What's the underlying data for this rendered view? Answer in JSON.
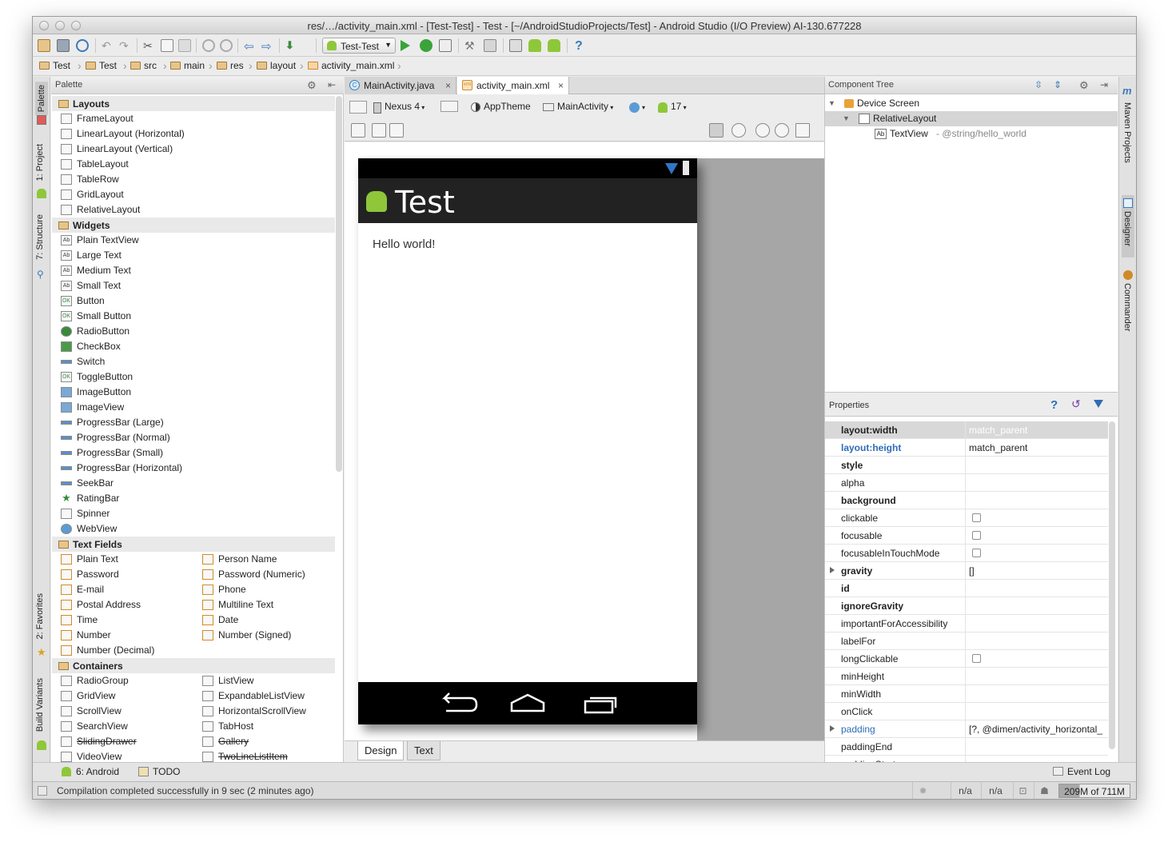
{
  "window": {
    "title": "res/…/activity_main.xml - [Test-Test] - Test - [~/AndroidStudioProjects/Test] - Android Studio (I/O Preview) AI-130.677228"
  },
  "toolbar": {
    "run_config": "Test-Test",
    "help": "?"
  },
  "breadcrumb": [
    "Test",
    "Test",
    "src",
    "main",
    "res",
    "layout",
    "activity_main.xml"
  ],
  "left_strip": {
    "palette": "Palette",
    "project": "1: Project",
    "structure": "7: Structure",
    "favorites": "2: Favorites",
    "build_variants": "Build Variants"
  },
  "right_strip": {
    "maven": "Maven Projects",
    "designer": "Designer",
    "commander": "Commander"
  },
  "palette": {
    "title": "Palette",
    "groups": {
      "layouts": "Layouts",
      "widgets": "Widgets",
      "text_fields": "Text Fields",
      "containers": "Containers"
    },
    "layouts": [
      "FrameLayout",
      "LinearLayout (Horizontal)",
      "LinearLayout (Vertical)",
      "TableLayout",
      "TableRow",
      "GridLayout",
      "RelativeLayout"
    ],
    "widgets": [
      "Plain TextView",
      "Large Text",
      "Medium Text",
      "Small Text",
      "Button",
      "Small Button",
      "RadioButton",
      "CheckBox",
      "Switch",
      "ToggleButton",
      "ImageButton",
      "ImageView",
      "ProgressBar (Large)",
      "ProgressBar (Normal)",
      "ProgressBar (Small)",
      "ProgressBar (Horizontal)",
      "SeekBar",
      "RatingBar",
      "Spinner",
      "WebView"
    ],
    "text_fields_left": [
      "Plain Text",
      "Password",
      "E-mail",
      "Postal Address",
      "Time",
      "Number",
      "Number (Decimal)"
    ],
    "text_fields_right": [
      "Person Name",
      "Password (Numeric)",
      "Phone",
      "Multiline Text",
      "Date",
      "Number (Signed)"
    ],
    "containers_left": [
      "RadioGroup",
      "GridView",
      "ScrollView",
      "SearchView",
      "SlidingDrawer",
      "VideoView"
    ],
    "containers_right": [
      "ListView",
      "ExpandableListView",
      "HorizontalScrollView",
      "TabHost",
      "Gallery",
      "TwoLineListItem"
    ],
    "icon_text": {
      "ab": "Ab",
      "ok": "OK"
    }
  },
  "editor": {
    "tabs": [
      {
        "label": "MainActivity.java",
        "icon": "C"
      },
      {
        "label": "activity_main.xml",
        "icon": "xml"
      }
    ],
    "close_glyph": "×",
    "device": "Nexus 4",
    "theme": "AppTheme",
    "activity": "MainActivity",
    "api": "17",
    "design_tabs": [
      "Design",
      "Text"
    ]
  },
  "preview": {
    "app_title": "Test",
    "hello": "Hello world!"
  },
  "component_tree": {
    "title": "Component Tree",
    "device_screen": "Device Screen",
    "relative_layout": "RelativeLayout",
    "text_view": "TextView",
    "text_view_detail": "- @string/hello_world"
  },
  "properties": {
    "title": "Properties",
    "help": "?",
    "rows": [
      {
        "name": "layout:width",
        "value": "match_parent"
      },
      {
        "name": "layout:height",
        "value": "match_parent"
      },
      {
        "name": "style",
        "value": ""
      },
      {
        "name": "alpha",
        "value": ""
      },
      {
        "name": "background",
        "value": ""
      },
      {
        "name": "clickable",
        "value": ""
      },
      {
        "name": "focusable",
        "value": ""
      },
      {
        "name": "focusableInTouchMode",
        "value": ""
      },
      {
        "name": "gravity",
        "value": "[]"
      },
      {
        "name": "id",
        "value": ""
      },
      {
        "name": "ignoreGravity",
        "value": ""
      },
      {
        "name": "importantForAccessibility",
        "value": ""
      },
      {
        "name": "labelFor",
        "value": ""
      },
      {
        "name": "longClickable",
        "value": ""
      },
      {
        "name": "minHeight",
        "value": ""
      },
      {
        "name": "minWidth",
        "value": ""
      },
      {
        "name": "onClick",
        "value": ""
      },
      {
        "name": "padding",
        "value": "[?, @dimen/activity_horizontal_"
      },
      {
        "name": "paddingEnd",
        "value": ""
      },
      {
        "name": "paddingStart",
        "value": ""
      }
    ]
  },
  "bottom_tools": {
    "android": "6: Android",
    "todo": "TODO",
    "event_log": "Event Log"
  },
  "status": {
    "message": "Compilation completed successfully in 9 sec (2 minutes ago)",
    "na1": "n/a",
    "na2": "n/a",
    "memory": "209M of 711M",
    "memory_used_fraction": 0.29
  },
  "colors": {
    "accent_blue": "#2f6db5",
    "android_green": "#8ec73a",
    "folder": "#e7c58a"
  }
}
